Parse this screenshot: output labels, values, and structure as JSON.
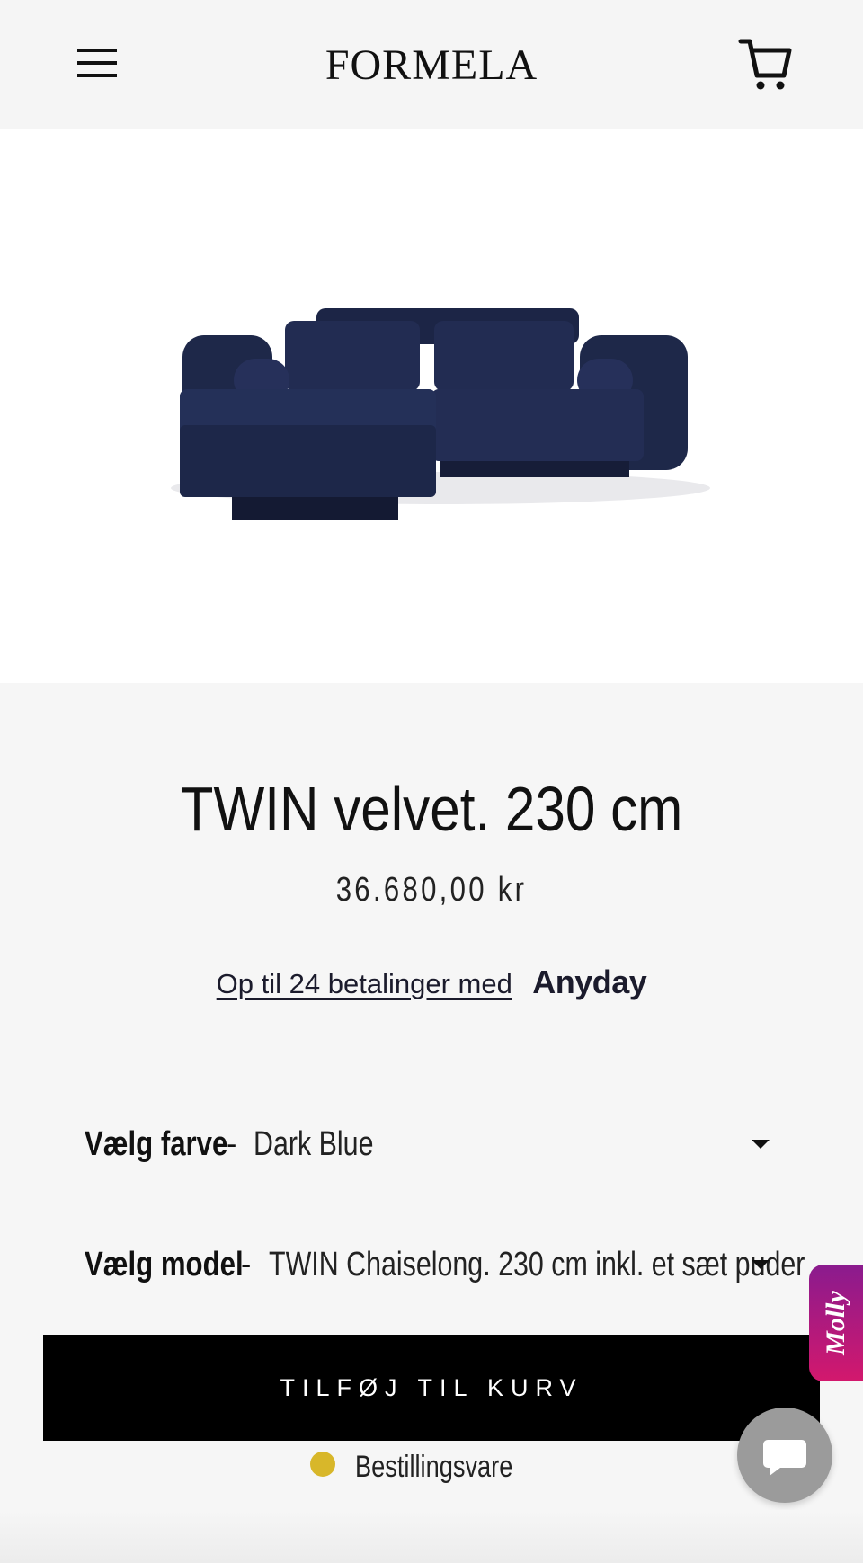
{
  "header": {
    "logo": "FORMELA",
    "menu_icon": "hamburger-menu-icon",
    "cart_icon": "shopping-cart-icon"
  },
  "product": {
    "image_icon": "sofa-product-image",
    "title": "TWIN velvet. 230 cm",
    "price": "36.680,00 kr",
    "installments_text": "Op til 24 betalinger med",
    "installments_brand": "Anyday",
    "color_option": {
      "label": "Vælg farve",
      "separator": "-",
      "value": "Dark Blue"
    },
    "model_option": {
      "label": "Vælg model",
      "separator": "-",
      "value": "TWIN Chaiselong. 230 cm inkl. et sæt puder"
    },
    "add_to_cart_label": "TILFØJ TIL KURV",
    "stock_status": "Bestillingsvare",
    "stock_color": "#d8b72a"
  },
  "widgets": {
    "molly_label": "Molly",
    "chat_icon": "chat-bubble-icon"
  },
  "colors": {
    "button_bg": "#000000",
    "sofa": "#1f2a4d",
    "molly_gradient_start": "#8a1b8e",
    "molly_gradient_end": "#d3186d"
  }
}
